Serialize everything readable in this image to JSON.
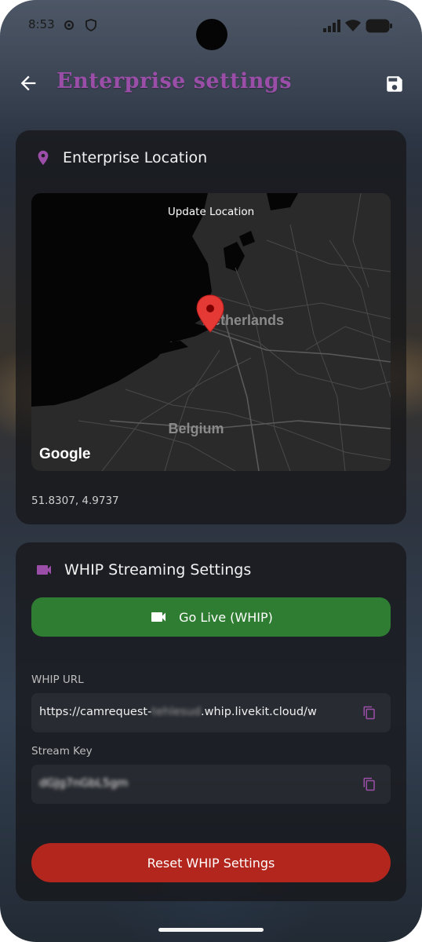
{
  "status_bar": {
    "time": "8:53",
    "icons": [
      "settings-icon",
      "shield-icon",
      "signal-icon",
      "wifi-icon",
      "battery-icon"
    ]
  },
  "app_bar": {
    "title": "Enterprise settings",
    "back_icon": "arrow-left-icon",
    "save_icon": "save-icon"
  },
  "location_card": {
    "title": "Enterprise Location",
    "icon": "location-pin-icon",
    "map": {
      "update_label": "Update Location",
      "labels": [
        "Netherlands",
        "Belgium"
      ],
      "attribution": "Google"
    },
    "coordinates": "51.8307, 4.9737"
  },
  "whip_card": {
    "title": "WHIP Streaming Settings",
    "icon": "videocam-icon",
    "go_live_label": "Go Live (WHIP)",
    "url_label": "WHIP URL",
    "url_value_prefix": "https://camrequest-",
    "url_value_redacted": "tehlesud",
    "url_value_suffix": ".whip.livekit.cloud/w",
    "stream_key_label": "Stream Key",
    "stream_key_value": "dGJg7nGbL5gm",
    "reset_label": "Reset WHIP Settings"
  },
  "colors": {
    "accent": "#9b4ea8",
    "go_live": "#2f7d32",
    "reset": "#b3261e"
  }
}
